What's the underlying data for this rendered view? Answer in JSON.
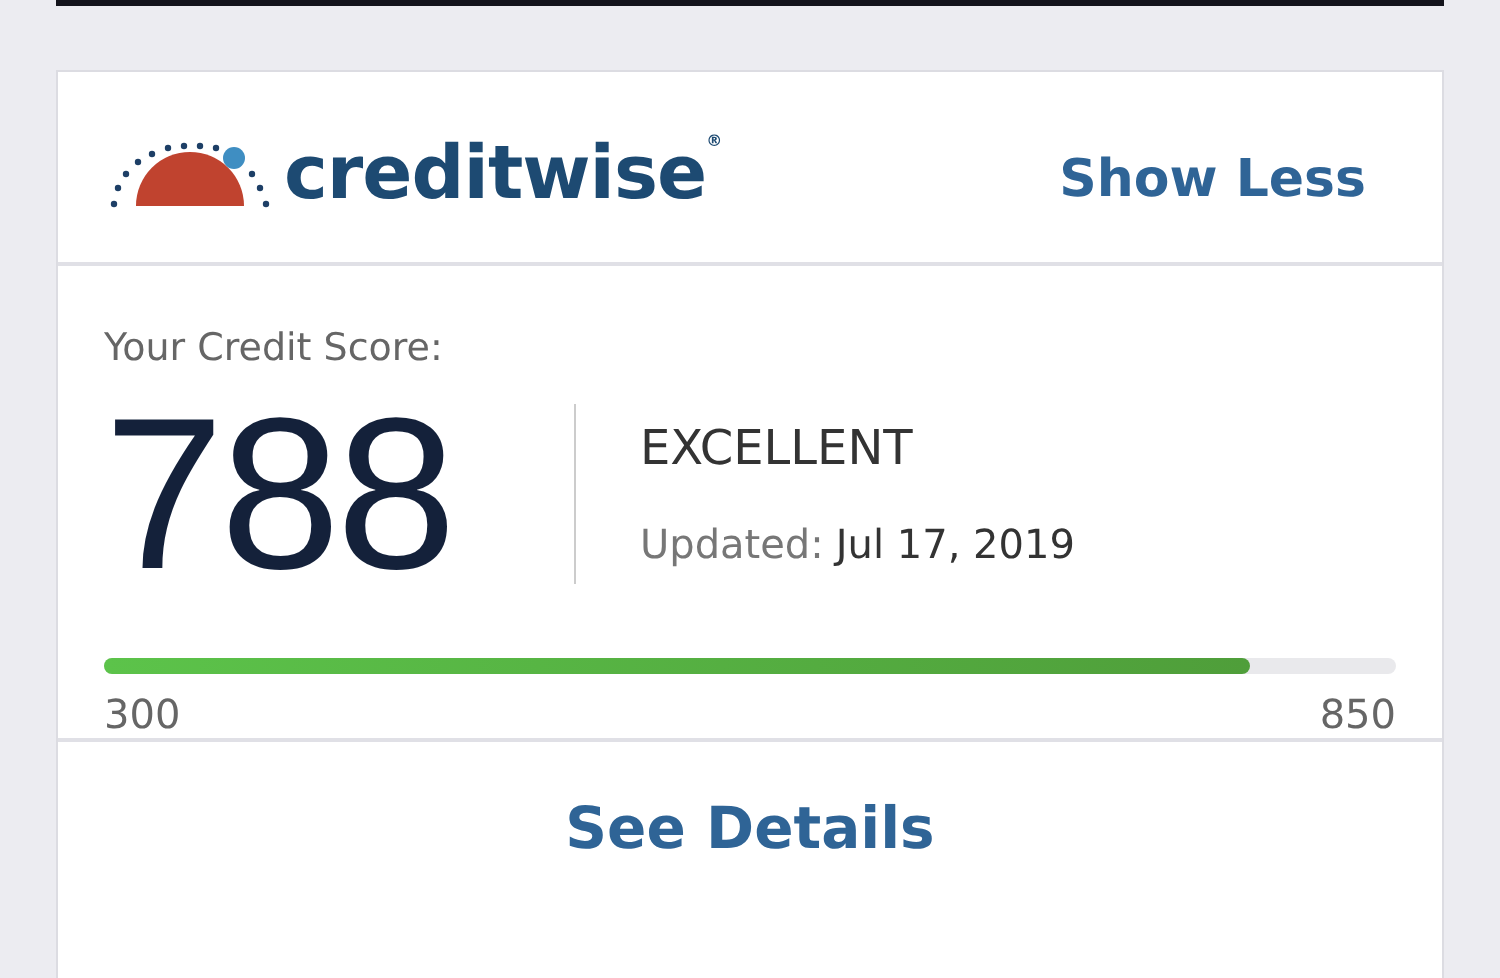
{
  "header": {
    "logo": "creditwise$^{®}$",
    "action": "Show Less"
  },
  "score": {
    "label": "Your Credit Score:",
    "value": "788",
    "rating": "EXCELLENT",
    "updated_label": "Updated:",
    "updated_date": "Jul 17, 2019",
    "level": 0.887,
    "min": "300",
    "max": "850"
  },
  "footer": {
    "action": "See Details"
  }
}
